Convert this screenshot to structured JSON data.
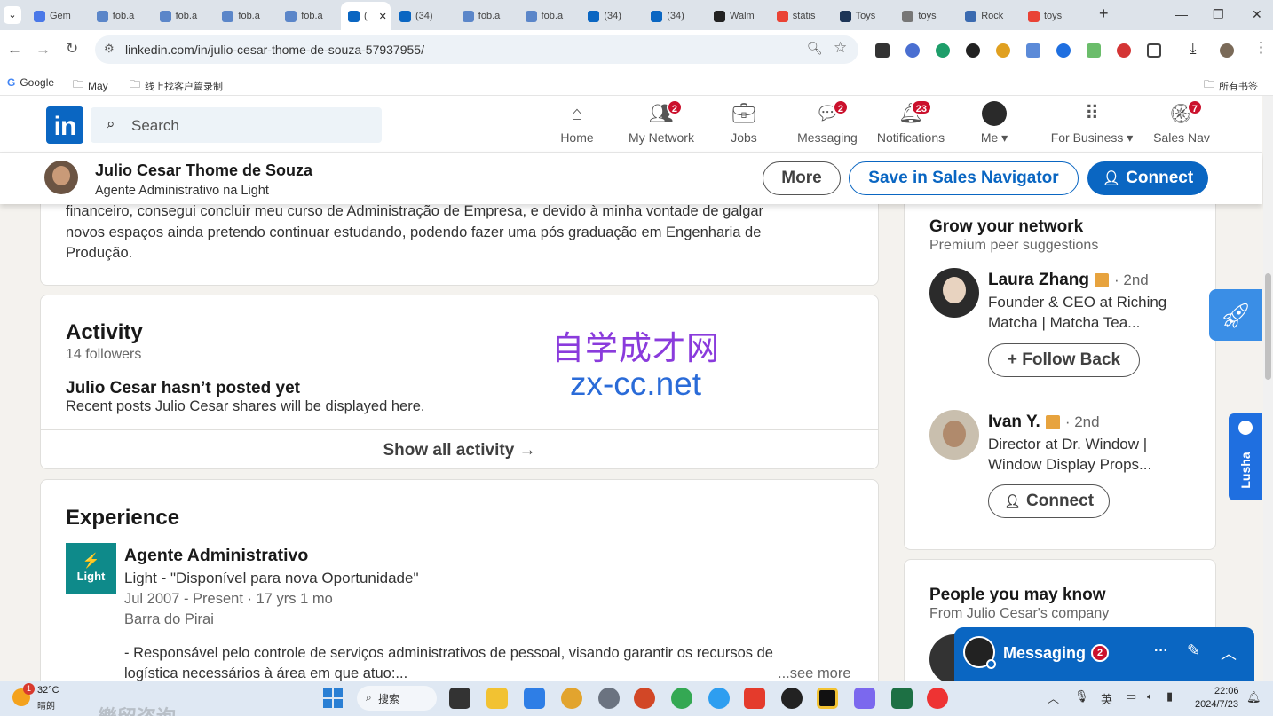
{
  "browser": {
    "tabs": [
      {
        "label": "Gem",
        "color": "#4a78e8"
      },
      {
        "label": "fob.a",
        "color": "#5b86c9"
      },
      {
        "label": "fob.a",
        "color": "#5b86c9"
      },
      {
        "label": "fob.a",
        "color": "#5b86c9"
      },
      {
        "label": "fob.a",
        "color": "#5b86c9"
      },
      {
        "label": "(",
        "color": "#0a66c2",
        "active": true
      },
      {
        "label": "(34)",
        "color": "#0a66c2"
      },
      {
        "label": "fob.a",
        "color": "#5b86c9"
      },
      {
        "label": "fob.a",
        "color": "#5b86c9"
      },
      {
        "label": "(34)",
        "color": "#0a66c2"
      },
      {
        "label": "(34)",
        "color": "#0a66c2"
      },
      {
        "label": "Walm",
        "color": "#222"
      },
      {
        "label": "statis",
        "color": "#ea4335"
      },
      {
        "label": "Toys",
        "color": "#1d3557"
      },
      {
        "label": "toys",
        "color": "#777"
      },
      {
        "label": "Rock",
        "color": "#3a6ab0"
      },
      {
        "label": "toys",
        "color": "#e94235"
      }
    ],
    "new_tab": "+",
    "url": "linkedin.com/in/julio-cesar-thome-de-souza-57937955/",
    "bookmarks": [
      "Google",
      "May",
      "线上找客户篇录制"
    ],
    "bookmarks_right": "所有书签"
  },
  "nav": {
    "logo": "in",
    "search_placeholder": "Search",
    "items": [
      {
        "label": "Home",
        "badge": ""
      },
      {
        "label": "My Network",
        "badge": "2"
      },
      {
        "label": "Jobs",
        "badge": ""
      },
      {
        "label": "Messaging",
        "badge": "2"
      },
      {
        "label": "Notifications",
        "badge": "23"
      },
      {
        "label": "Me",
        "badge": ""
      },
      {
        "label": "For Business",
        "badge": ""
      },
      {
        "label": "Sales Nav",
        "badge": "7"
      }
    ]
  },
  "profile_bar": {
    "name": "Julio Cesar Thome de Souza",
    "headline": "Agente Administrativo na Light",
    "more": "More",
    "save": "Save in Sales Navigator",
    "connect": "Connect"
  },
  "about": {
    "text1": "financeiro, consegui concluir meu curso de Administração de Empresa, e devido à minha vontade de galgar",
    "text2": "novos espaços ainda pretendo continuar estudando, podendo fazer uma pós graduação em Engenharia de",
    "text3": "Produção."
  },
  "activity": {
    "title": "Activity",
    "followers": "14 followers",
    "empty_title": "Julio Cesar hasn’t posted yet",
    "empty_desc": "Recent posts Julio Cesar shares will be displayed here.",
    "show_all": "Show all activity →"
  },
  "experience": {
    "title": "Experience",
    "role": "Agente Administrativo",
    "logo": "Light",
    "company": "Light - \"Disponível para nova Oportunidade\"",
    "dates": "Jul 2007 - Present · 17 yrs 1 mo",
    "location": "Barra do Pirai",
    "desc1": "- Responsável pelo controle de serviços administrativos de pessoal, visando garantir os recursos de",
    "desc2": "logística necessários à área em que atuo:...",
    "see_more": "...see more"
  },
  "grow": {
    "title": "Grow your network",
    "subtitle": "Premium peer suggestions",
    "people": [
      {
        "name": "Laura Zhang",
        "degree": "· 2nd",
        "line1": "Founder & CEO at Riching",
        "line2": "Matcha | Matcha Tea...",
        "action": "+ Follow Back"
      },
      {
        "name": "Ivan Y.",
        "degree": "· 2nd",
        "line1": "Director at Dr. Window |",
        "line2": "Window Display Props...",
        "action": "Connect"
      }
    ]
  },
  "pymk": {
    "title": "People you may know",
    "subtitle": "From Julio Cesar's company"
  },
  "messaging_widget": {
    "label": "Messaging",
    "badge": "2",
    "more": "···"
  },
  "watermark": {
    "line1": "自学成才网",
    "line2": "zx-cc.net"
  },
  "lusha": {
    "label": "Lusha"
  },
  "taskbar": {
    "weather_temp": "32°C",
    "weather_desc": "晴朗",
    "weather_badge": "1",
    "search": "搜索",
    "lang": "英",
    "time": "22:06",
    "date": "2024/7/23",
    "bottom_text": "樂留咨询"
  }
}
